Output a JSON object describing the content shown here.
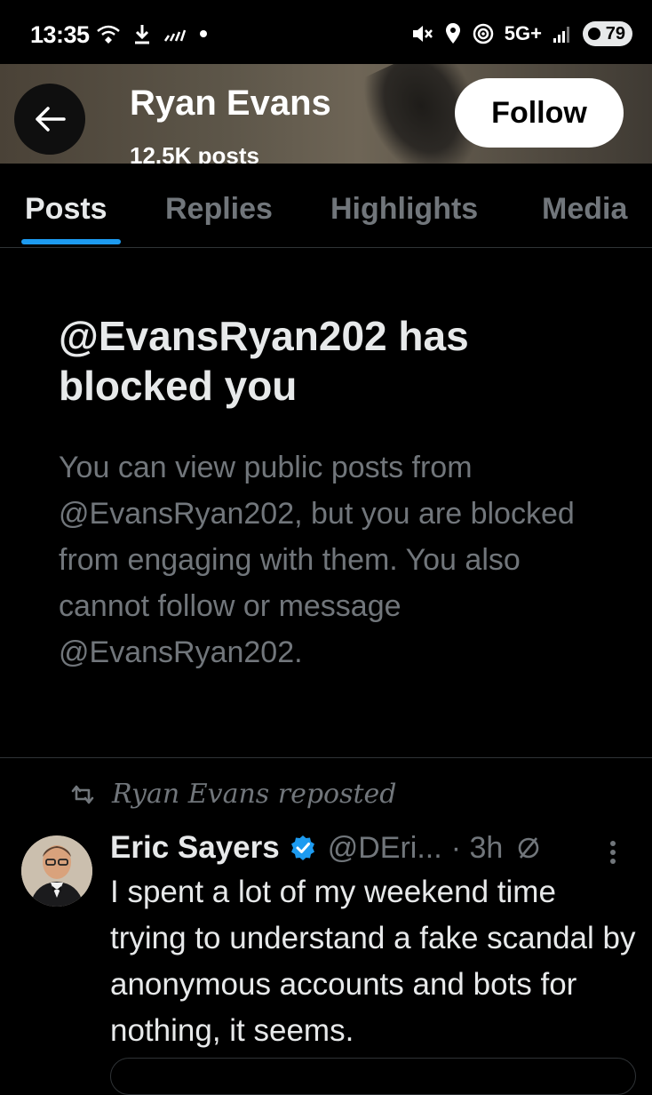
{
  "status_bar": {
    "time": "13:35",
    "network": "5G+",
    "battery": "79",
    "icons_left": [
      "wifi-calling-icon",
      "download-icon",
      "signal-off-icon",
      "dot-icon"
    ],
    "icons_right": [
      "mute-icon",
      "location-icon",
      "hotspot-icon",
      "signal-bars-icon",
      "battery-icon"
    ]
  },
  "header": {
    "name": "Ryan Evans",
    "posts_count": "12.5K posts",
    "follow_label": "Follow"
  },
  "tabs": [
    {
      "label": "Posts",
      "active": true
    },
    {
      "label": "Replies",
      "active": false
    },
    {
      "label": "Highlights",
      "active": false
    },
    {
      "label": "Media",
      "active": false
    }
  ],
  "blocked": {
    "title": "@EvansRyan202 has blocked you",
    "description": "You can view public posts from @EvansRyan202, but you are blocked from engaging with them. You also cannot follow or message @EvansRyan202."
  },
  "tweet": {
    "repost_label": "Ryan Evans reposted",
    "author_name": "Eric Sayers",
    "handle": "@DEri...",
    "time": "· 3h",
    "text": "I spent a lot of my weekend time trying to understand a fake scandal by anonymous accounts and bots for nothing, it seems."
  },
  "colors": {
    "accent": "#1d9bf0",
    "text_primary": "#e7e9ea",
    "text_secondary": "#71767b",
    "border": "#2f3336"
  }
}
